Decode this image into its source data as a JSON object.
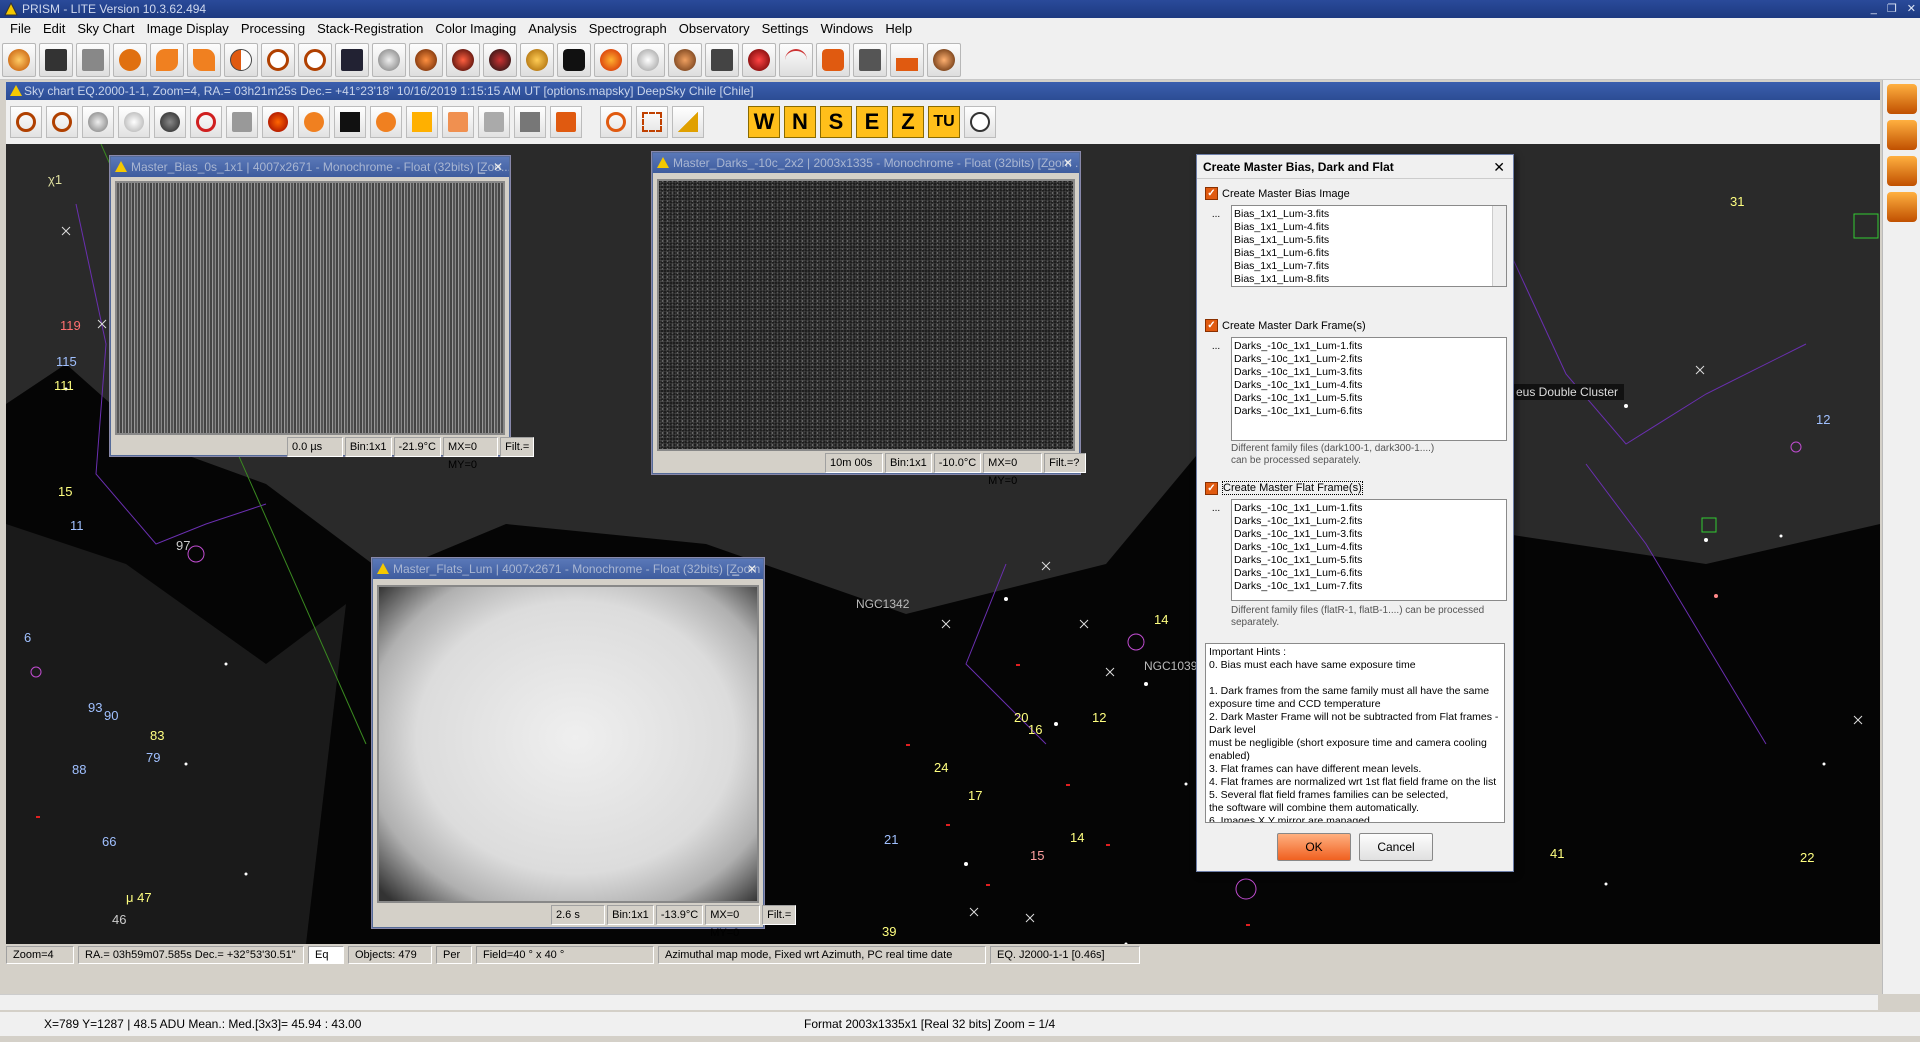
{
  "window": {
    "title": "PRISM - LITE Version  10.3.62.494",
    "controls": [
      "_",
      "❐",
      "✕"
    ]
  },
  "menu": [
    "File",
    "Edit",
    "Sky Chart",
    "Image Display",
    "Processing",
    "Stack-Registration",
    "Color Imaging",
    "Analysis",
    "Spectrograph",
    "Observatory",
    "Settings",
    "Windows",
    "Help"
  ],
  "toolbar_icons": [
    "open-icon",
    "save-icon",
    "scanner-icon",
    "info-icon",
    "undo-icon",
    "redo-icon",
    "contrast-icon",
    "zoom-out-icon",
    "zoom-in-icon",
    "fit-icon",
    "gear-icon",
    "camera-icon",
    "camera2-icon",
    "filter-wheel-icon",
    "focuser-icon",
    "telescope-icon",
    "fire-icon",
    "ball-icon",
    "pen-icon",
    "pdp-icon",
    "magnet-icon",
    "curve-icon",
    "hand-icon",
    "frame-icon",
    "histogram-icon",
    "camera3-icon"
  ],
  "skychart": {
    "title": "Sky chart EQ.2000-1-1, Zoom=4, RA.= 03h21m25s Dec.= +41°23'18\"  10/16/2019 1:15:15 AM UT [options.mapsky]  DeepSky Chile [Chile]",
    "direction_buttons": [
      "W",
      "N",
      "S",
      "E",
      "Z",
      "TU"
    ],
    "labels": {
      "chi1": "χ1",
      "n119": "119",
      "n115": "115",
      "n111": "111",
      "n15": "15",
      "n11": "11",
      "n97": "97",
      "n88": "88",
      "n66": "66",
      "n46": "46",
      "mu47": "μ 47",
      "n83": "83",
      "n79": "79",
      "n93": "93",
      "n90": "90",
      "n6": "6",
      "n31": "31",
      "n12": "12",
      "n14": "14",
      "n16": "16",
      "n20": "20",
      "n24": "24",
      "n17": "17",
      "n15b": "15",
      "n14b": "14",
      "n21": "21",
      "n39": "39",
      "n41": "41",
      "n22": "22",
      "ngc1342": "NGC1342",
      "ngc1039": "NGC1039",
      "double_cluster": "eus Double Cluster"
    }
  },
  "bias_window": {
    "title": "Master_Bias_0s_1x1 | 4007x2671 - Monochrome - Float (32bits)  [Zoo...",
    "status": [
      "0.0 µs",
      "Bin:1x1",
      "-21.9°C",
      "MX=0 MY=0",
      "Filt.="
    ]
  },
  "darks_window": {
    "title": "Master_Darks_-10c_2x2 | 2003x1335 - Monochrome - Float (32bits)  [Zoom ...",
    "status": [
      "10m 00s",
      "Bin:1x1",
      "-10.0°C",
      "MX=0 MY=0",
      "Filt.=?"
    ]
  },
  "flats_window": {
    "title": "Master_Flats_Lum | 4007x2671 - Monochrome - Float (32bits)  [Zoom ...",
    "status": [
      "2.6 s",
      "Bin:1x1",
      "-13.9°C",
      "MX=0 MY=0",
      "Filt.="
    ]
  },
  "dialog": {
    "title": "Create Master Bias, Dark and Flat",
    "bias": {
      "label": "Create Master Bias Image",
      "files": [
        "Bias_1x1_Lum-3.fits",
        "Bias_1x1_Lum-4.fits",
        "Bias_1x1_Lum-5.fits",
        "Bias_1x1_Lum-6.fits",
        "Bias_1x1_Lum-7.fits",
        "Bias_1x1_Lum-8.fits"
      ]
    },
    "dark": {
      "label": "Create Master Dark Frame(s)",
      "files": [
        "Darks_-10c_1x1_Lum-1.fits",
        "Darks_-10c_1x1_Lum-2.fits",
        "Darks_-10c_1x1_Lum-3.fits",
        "Darks_-10c_1x1_Lum-4.fits",
        "Darks_-10c_1x1_Lum-5.fits",
        "Darks_-10c_1x1_Lum-6.fits"
      ],
      "note": "Different family files (dark100-1, dark300-1....)\ncan be processed separately."
    },
    "flat": {
      "label": "Create Master Flat Frame(s)",
      "files": [
        "Darks_-10c_1x1_Lum-1.fits",
        "Darks_-10c_1x1_Lum-2.fits",
        "Darks_-10c_1x1_Lum-3.fits",
        "Darks_-10c_1x1_Lum-4.fits",
        "Darks_-10c_1x1_Lum-5.fits",
        "Darks_-10c_1x1_Lum-6.fits",
        "Darks_-10c_1x1_Lum-7.fits"
      ],
      "note": "Different family files (flatR-1, flatB-1....) can be processed separately."
    },
    "hints": "Important Hints :\n0. Bias must each have same exposure time\n\n1. Dark frames from the same family must all have the same exposure time and CCD temperature\n2. Dark Master Frame will not be subtracted from Flat frames - Dark level\nmust be negligible (short exposure time and camera cooling enabled)\n3. Flat frames can have different mean levels.\n4. Flat frames are normalized wrt 1st flat field frame on the list\n5. Several flat field frames families can be selected,\nthe software will combine them automatically.\n6. Images X,Y mirror are managed",
    "ok": "OK",
    "cancel": "Cancel",
    "browse": "..."
  },
  "chart_status": {
    "zoom": "Zoom=4",
    "radec": "RA.= 03h59m07.585s Dec.= +32°53'30.51\"",
    "eq": "Eq",
    "objects": "Objects: 479",
    "per": "Per",
    "field": "Field=40 ° x 40 °",
    "mode": "Azimuthal map mode, Fixed wrt Azimuth, PC real time date",
    "epoch": "EQ. J2000-1-1 [0.46s]"
  },
  "main_status": {
    "left": "X=789 Y=1287 | 48.5 ADU   Mean.: Med.[3x3]= 45.94 : 43.00",
    "right": "Format 2003x1335x1 [Real 32 bits]  Zoom = 1/4"
  },
  "colors": {
    "accent": "#e05a10",
    "title_blue": "#2c4d94",
    "dir_yellow": "#ffbf1a"
  }
}
